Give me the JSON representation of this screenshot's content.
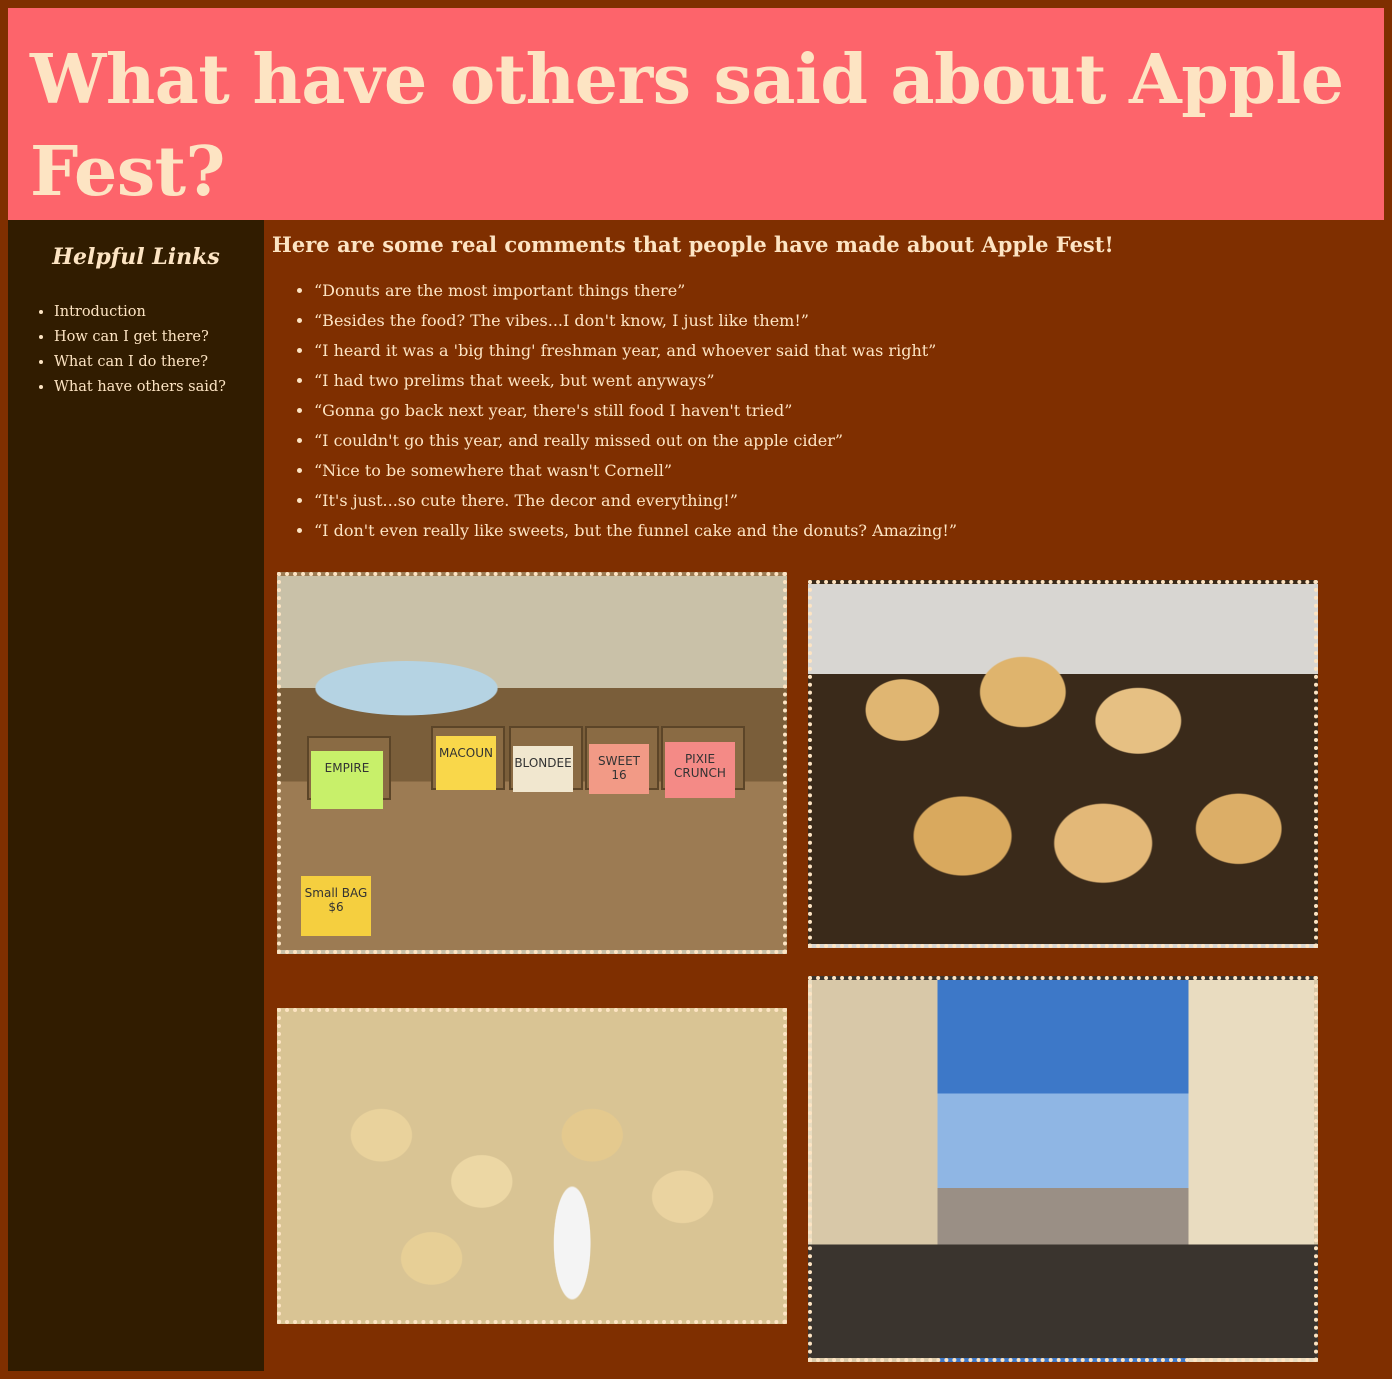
{
  "header": {
    "title": "What have others said about Apple Fest?"
  },
  "sidebar": {
    "heading": "Helpful Links",
    "links": [
      "Introduction",
      "How can I get there?",
      "What can I do there?",
      "What have others said?"
    ]
  },
  "main": {
    "heading": "Here are some real comments that people have made about Apple Fest!",
    "quotes": [
      "“Donuts are the most important things there”",
      "“Besides the food? The vibes...I don't know, I just like them!”",
      "“I heard it was a 'big thing' freshman year, and whoever said that was right”",
      "“I had two prelims that week, but went anyways”",
      "“Gonna go back next year, there's still food I haven't tried”",
      "“I couldn't go this year, and really missed out on the apple cider”",
      "“Nice to be somewhere that wasn't Cornell”",
      "“It's just...so cute there. The decor and everything!”",
      "“I don't even really like sweets, but the funnel cake and the donuts? Amazing!”"
    ]
  },
  "photos": {
    "apples": {
      "signs": [
        "EMPIRE",
        "MACOUN",
        "BLONDEE",
        "SWEET 16",
        "PIXIE CRUNCH",
        "Small BAG $6"
      ]
    }
  },
  "colors": {
    "page_background": "#7f2f00",
    "header_background": "#fd646b",
    "sidebar_background": "#311c00",
    "text": "#fde4c3"
  }
}
